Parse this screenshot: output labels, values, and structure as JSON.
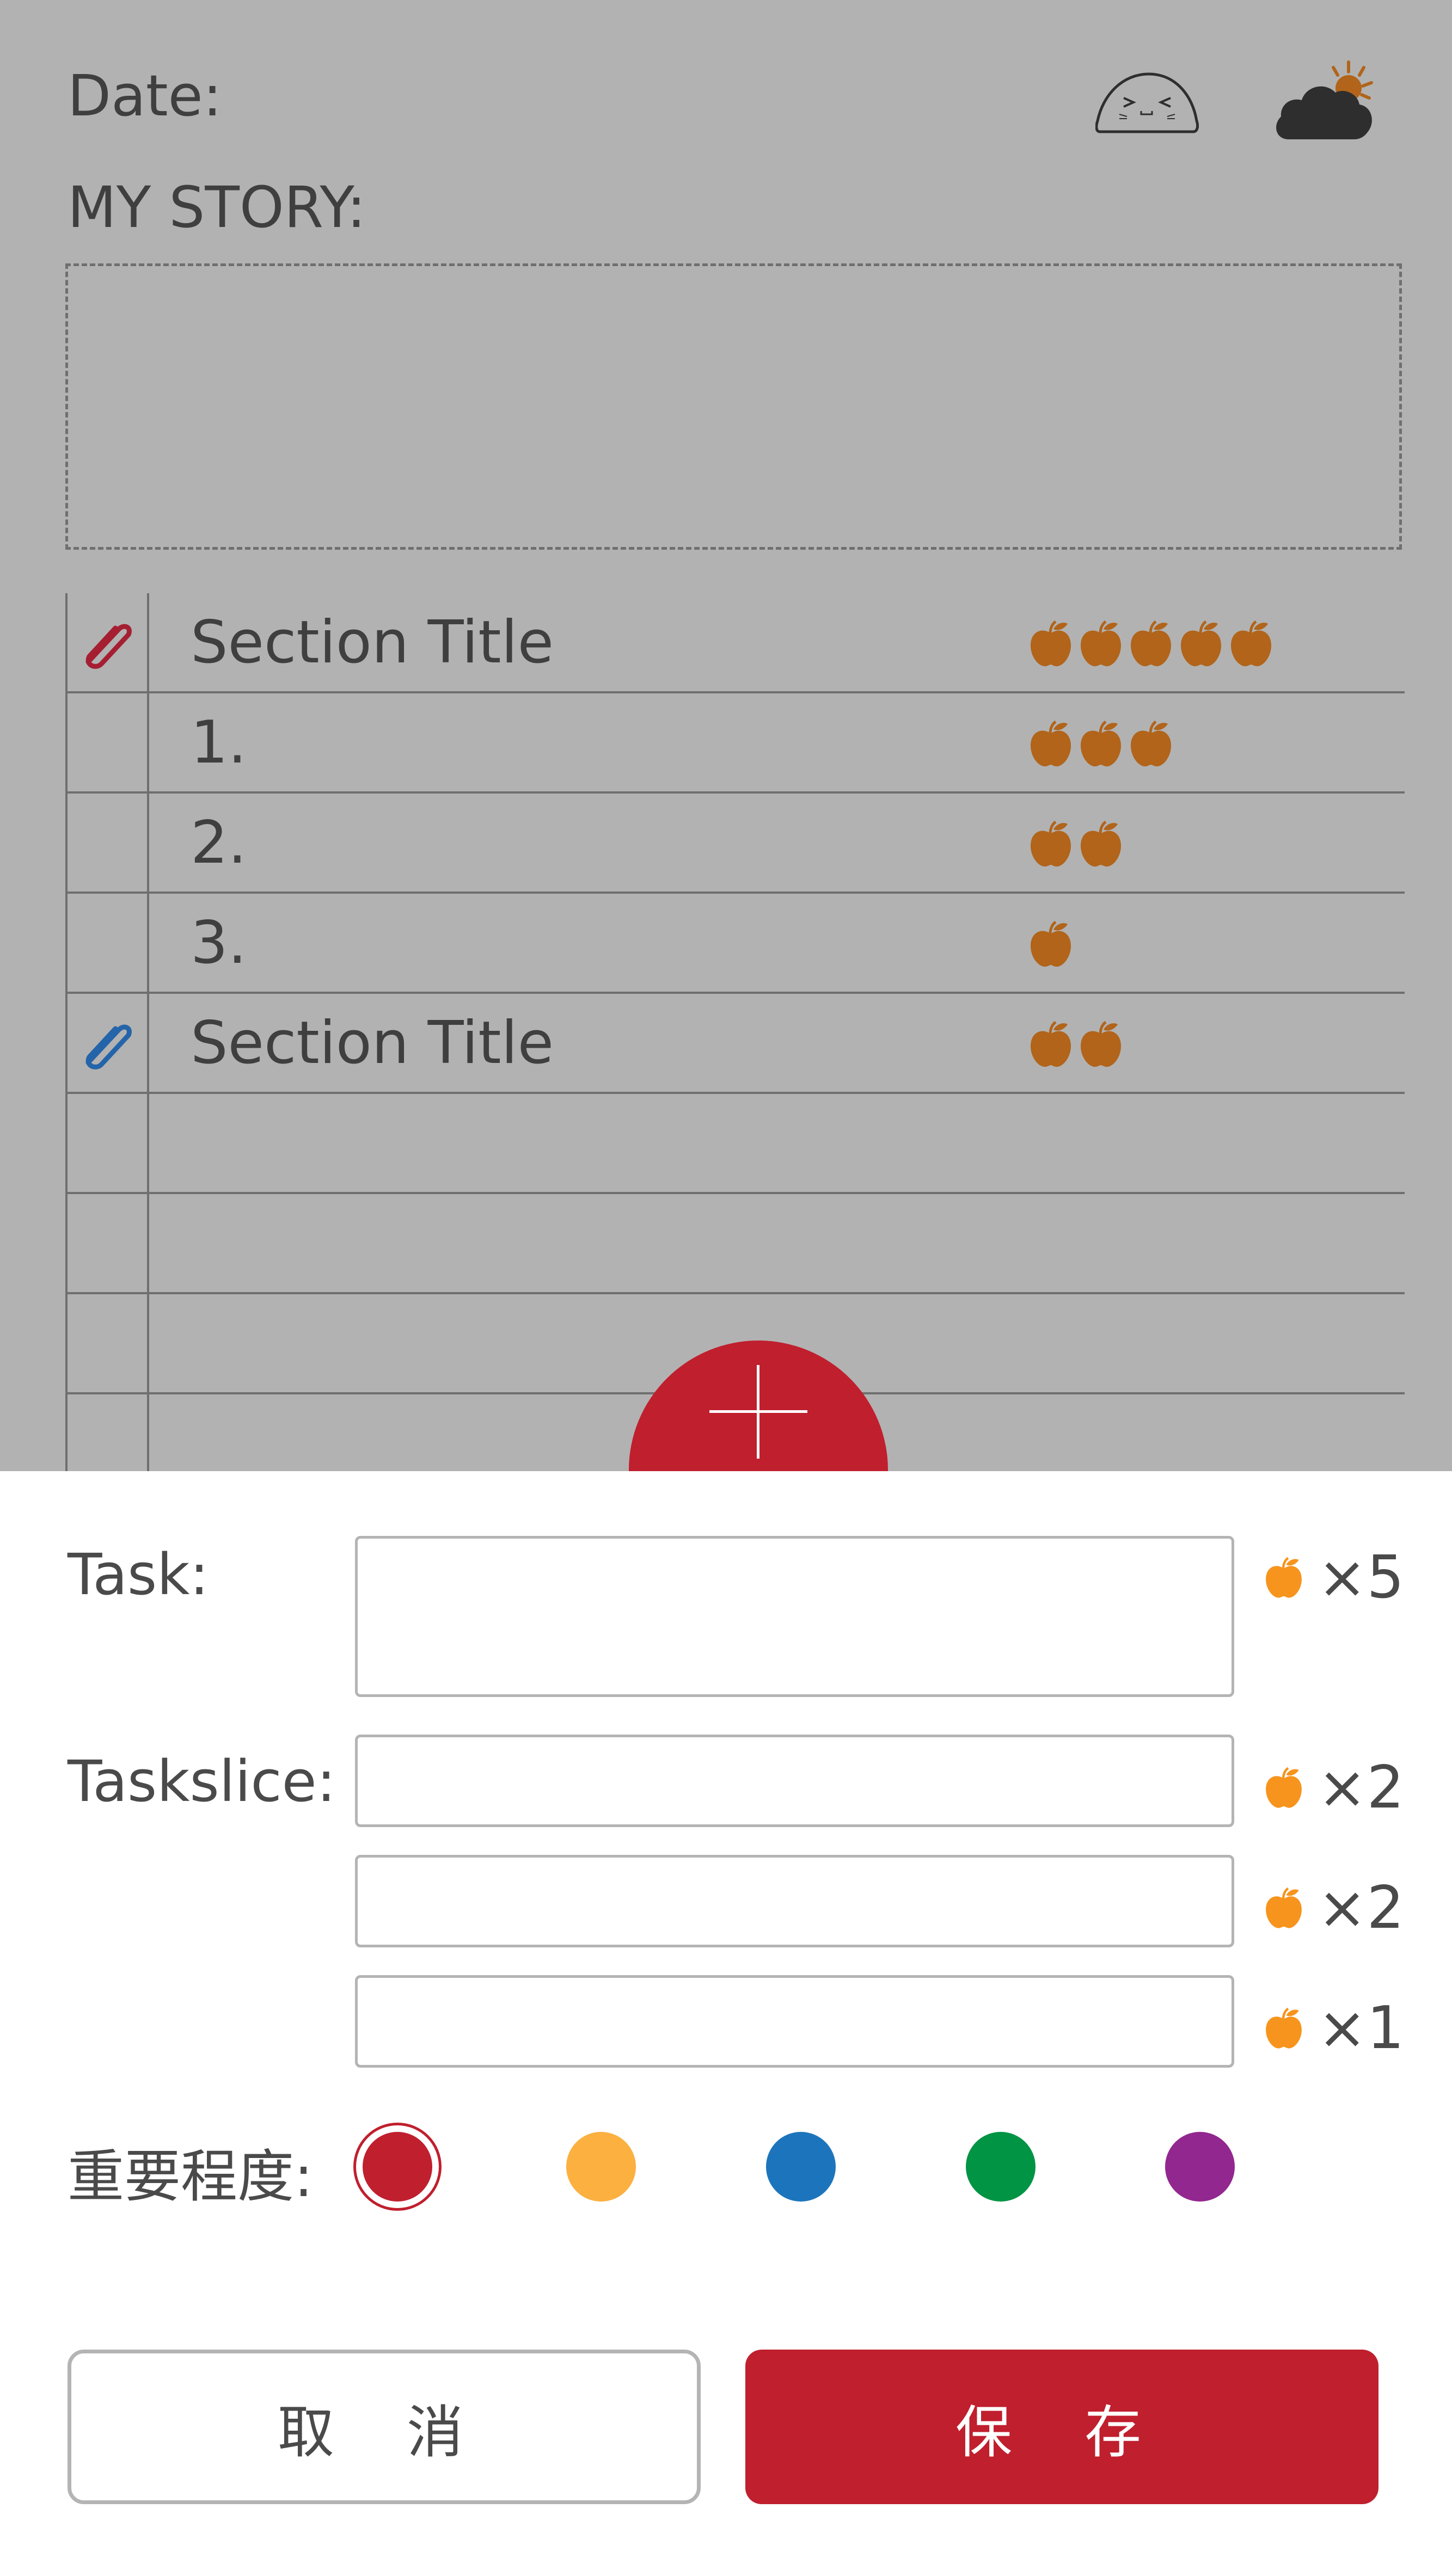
{
  "header": {
    "date_label": "Date:",
    "story_label": "MY STORY:",
    "mood_icon": "squint-face-icon",
    "weather_icon": "cloud-sun-icon"
  },
  "table": {
    "rows": [
      {
        "text": "Section Title",
        "apples": 5,
        "clip": "red"
      },
      {
        "text": "1.",
        "apples": 3
      },
      {
        "text": "2.",
        "apples": 2
      },
      {
        "text": "3.",
        "apples": 1
      },
      {
        "text": "Section Title",
        "apples": 2,
        "clip": "blue"
      },
      {
        "text": ""
      },
      {
        "text": ""
      },
      {
        "text": ""
      }
    ]
  },
  "form": {
    "task_label": "Task:",
    "taskslice_label": "Taskslice:",
    "importance_label": "重要程度:",
    "task_value": "",
    "slices": [
      "",
      "",
      ""
    ],
    "multipliers": [
      "×5",
      "×2",
      "×2",
      "×1"
    ],
    "importance_colors": [
      "#c01f2e",
      "#fbb040",
      "#1c75bc",
      "#009444",
      "#92278f"
    ],
    "selected_importance": 0
  },
  "buttons": {
    "cancel": "取 消",
    "save": "保 存"
  },
  "colors": {
    "accent": "#c01f2e",
    "dim_overlay": "#b2b2b2",
    "apple_dim": "#b1641a",
    "apple": "#f7941d",
    "clip_red": "#a51e31",
    "clip_blue": "#2464a9"
  }
}
